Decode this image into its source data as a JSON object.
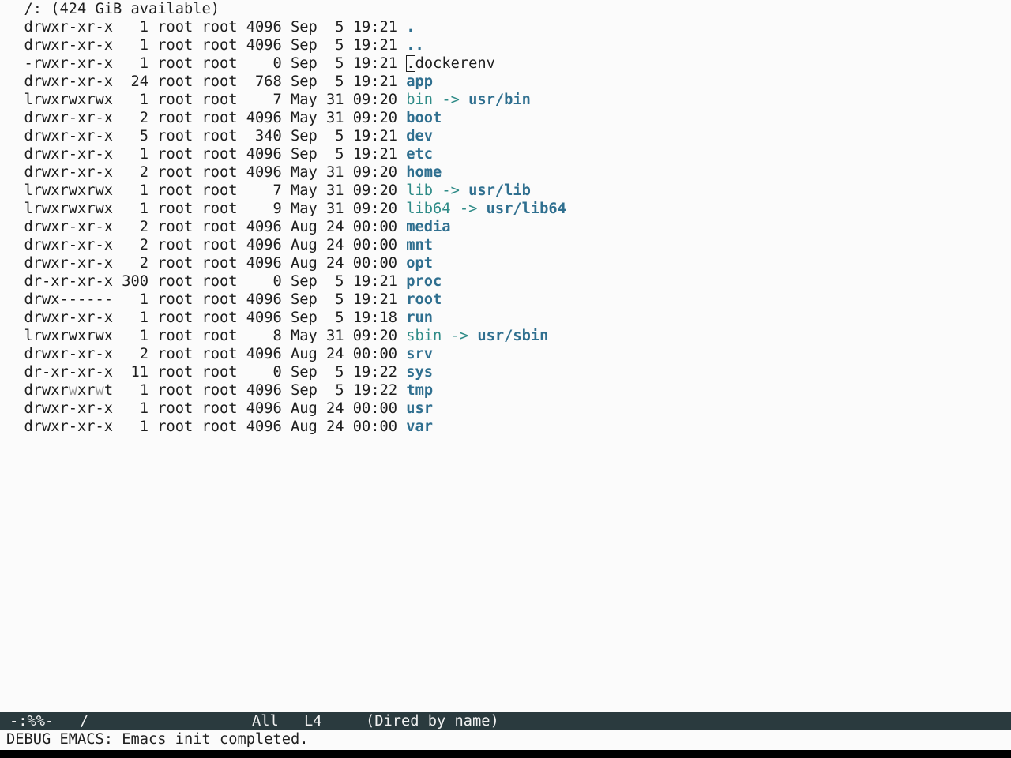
{
  "header": "  /: (424 GiB available)",
  "listing": [
    {
      "meta": "  drwxr-xr-x   1 root root 4096 Sep  5 19:21 ",
      "name": ".",
      "kind": "dir"
    },
    {
      "meta": "  drwxr-xr-x   1 root root 4096 Sep  5 19:21 ",
      "name": "..",
      "kind": "dir"
    },
    {
      "meta": "  -rwxr-xr-x   1 root root    0 Sep  5 19:21 ",
      "name": ".dockerenv",
      "kind": "file",
      "cursor": true
    },
    {
      "meta": "  drwxr-xr-x  24 root root  768 Sep  5 19:21 ",
      "name": "app",
      "kind": "dir"
    },
    {
      "meta": "  lrwxrwxrwx   1 root root    7 May 31 09:20 ",
      "name": "bin",
      "kind": "link",
      "target": "usr/bin"
    },
    {
      "meta": "  drwxr-xr-x   2 root root 4096 May 31 09:20 ",
      "name": "boot",
      "kind": "dir"
    },
    {
      "meta": "  drwxr-xr-x   5 root root  340 Sep  5 19:21 ",
      "name": "dev",
      "kind": "dir"
    },
    {
      "meta": "  drwxr-xr-x   1 root root 4096 Sep  5 19:21 ",
      "name": "etc",
      "kind": "dir"
    },
    {
      "meta": "  drwxr-xr-x   2 root root 4096 May 31 09:20 ",
      "name": "home",
      "kind": "dir"
    },
    {
      "meta": "  lrwxrwxrwx   1 root root    7 May 31 09:20 ",
      "name": "lib",
      "kind": "link",
      "target": "usr/lib"
    },
    {
      "meta": "  lrwxrwxrwx   1 root root    9 May 31 09:20 ",
      "name": "lib64",
      "kind": "link",
      "target": "usr/lib64"
    },
    {
      "meta": "  drwxr-xr-x   2 root root 4096 Aug 24 00:00 ",
      "name": "media",
      "kind": "dir"
    },
    {
      "meta": "  drwxr-xr-x   2 root root 4096 Aug 24 00:00 ",
      "name": "mnt",
      "kind": "dir"
    },
    {
      "meta": "  drwxr-xr-x   2 root root 4096 Aug 24 00:00 ",
      "name": "opt",
      "kind": "dir"
    },
    {
      "meta": "  dr-xr-xr-x 300 root root    0 Sep  5 19:21 ",
      "name": "proc",
      "kind": "dir"
    },
    {
      "meta": "  drwx------   1 root root 4096 Sep  5 19:21 ",
      "name": "root",
      "kind": "dir"
    },
    {
      "meta": "  drwxr-xr-x   1 root root 4096 Sep  5 19:18 ",
      "name": "run",
      "kind": "dir"
    },
    {
      "meta": "  lrwxrwxrwx   1 root root    8 May 31 09:20 ",
      "name": "sbin",
      "kind": "link",
      "target": "usr/sbin"
    },
    {
      "meta": "  drwxr-xr-x   2 root root 4096 Aug 24 00:00 ",
      "name": "srv",
      "kind": "dir"
    },
    {
      "meta": "  dr-xr-xr-x  11 root root    0 Sep  5 19:22 ",
      "name": "sys",
      "kind": "dir"
    },
    {
      "meta": "  drwxrwxrwt   1 root root 4096 Sep  5 19:22 ",
      "name": "tmp",
      "kind": "dir",
      "sticky": true
    },
    {
      "meta": "  drwxr-xr-x   1 root root 4096 Aug 24 00:00 ",
      "name": "usr",
      "kind": "dir"
    },
    {
      "meta": "  drwxr-xr-x   1 root root 4096 Aug 24 00:00 ",
      "name": "var",
      "kind": "dir"
    }
  ],
  "link_arrow": " -> ",
  "modeline": {
    "status": "-:%%-",
    "buffer_name": "/",
    "position": "All",
    "line": "L4",
    "mode": "(Dired by name)"
  },
  "minibuffer": "DEBUG EMACS: Emacs init completed.",
  "colors": {
    "directory": "#2f6f8f",
    "symlink": "#2e8b87",
    "modeline_bg": "#2a3a3e",
    "background": "#fbfbfb"
  }
}
